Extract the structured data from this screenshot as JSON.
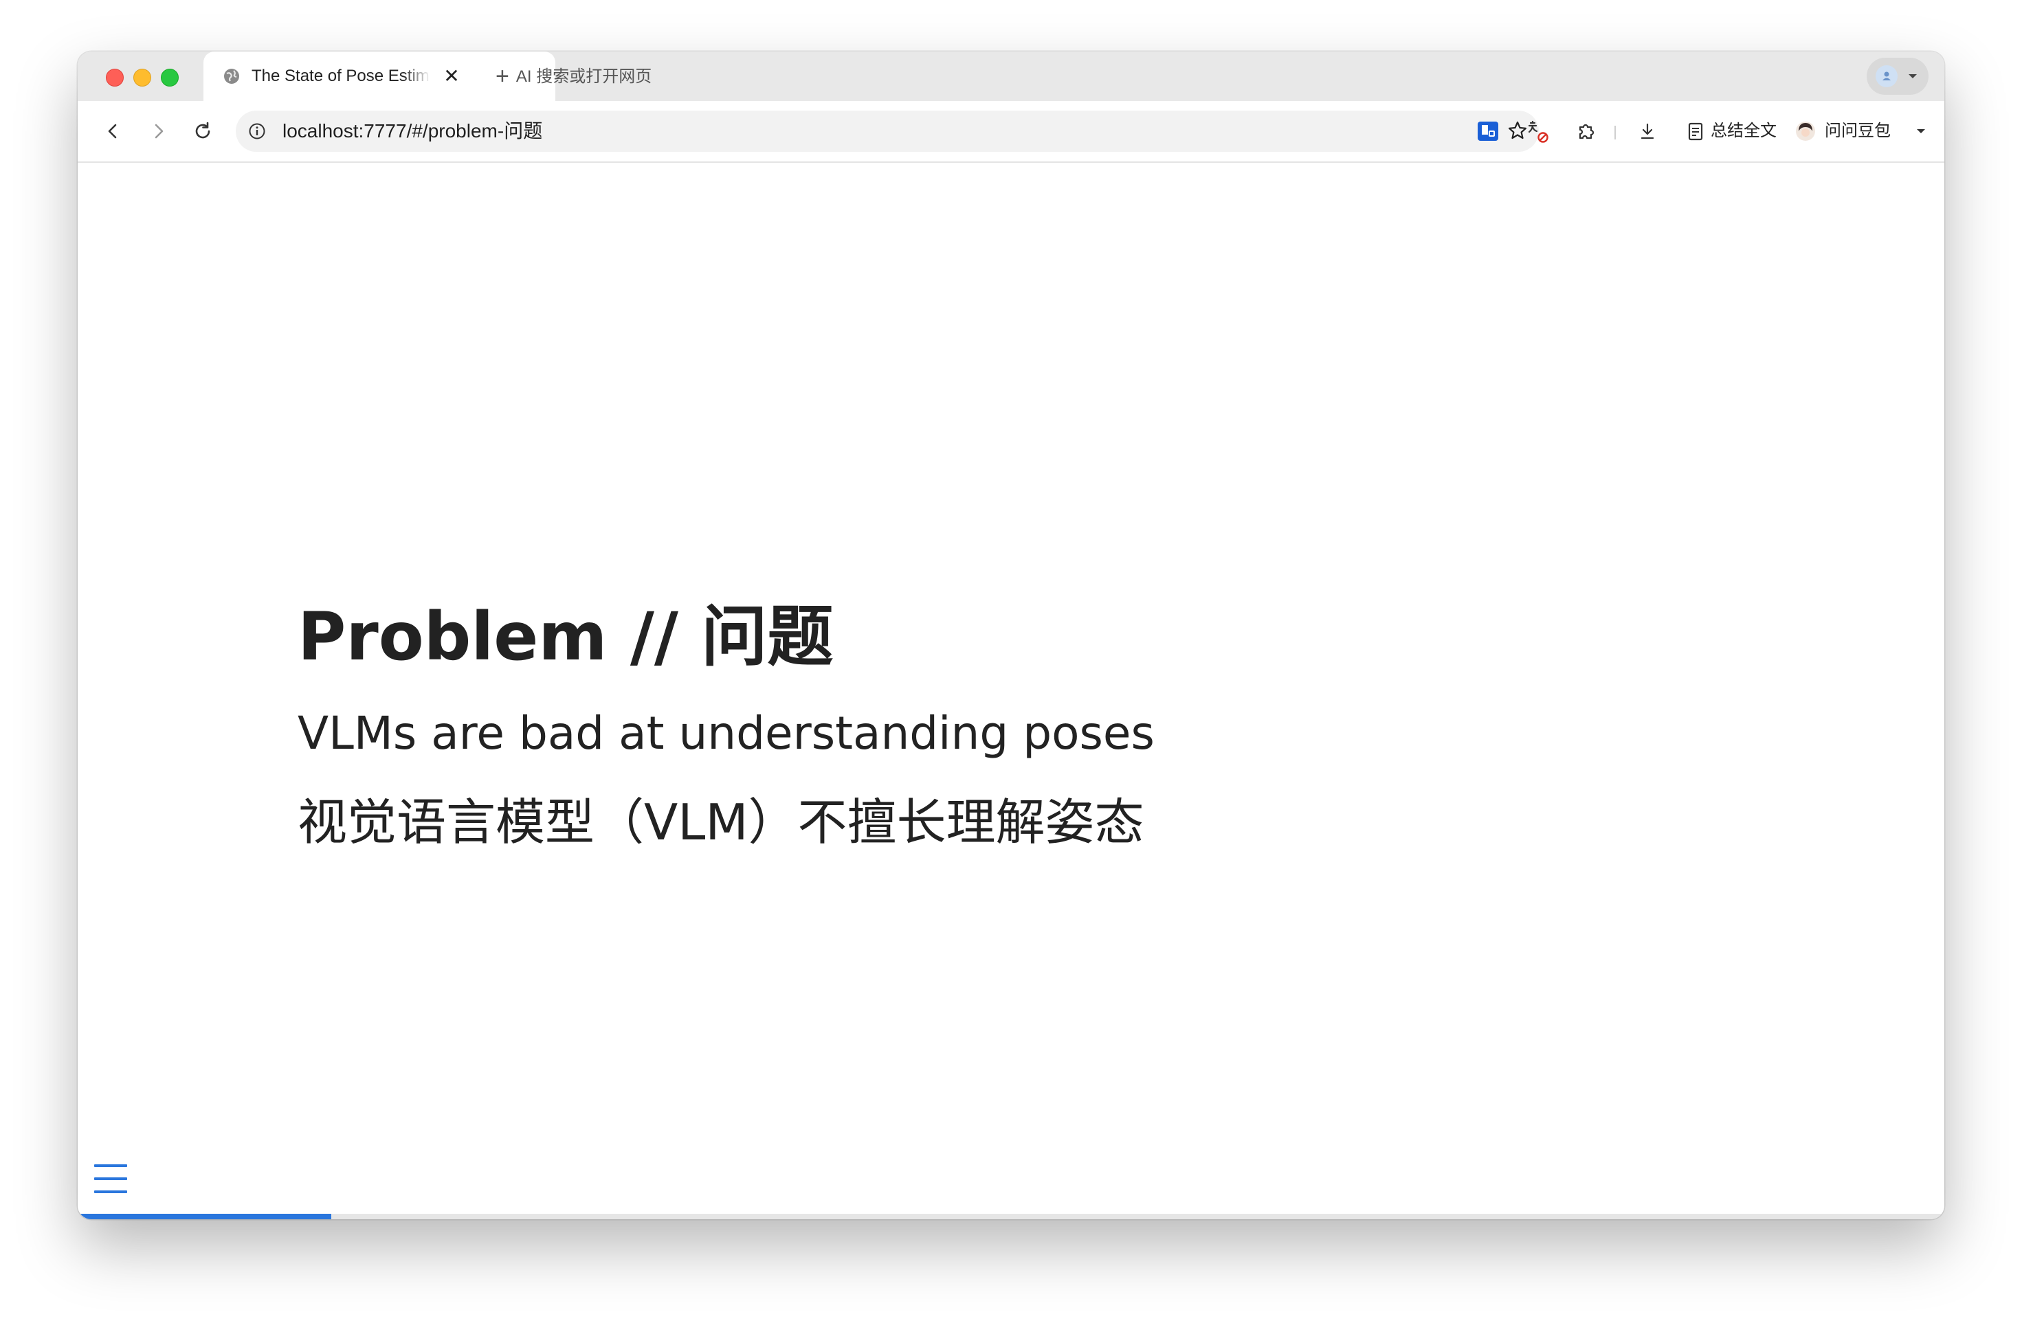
{
  "browser": {
    "tab": {
      "title": "The State of Pose Estimation",
      "close_glyph": "✕"
    },
    "new_tab": {
      "plus": "+",
      "label": "AI 搜索或打开网页"
    },
    "address": {
      "url": "localhost:7777/#/problem-问题"
    },
    "toolbar": {
      "summary_label": "总结全文",
      "doubao_label": "问问豆包"
    }
  },
  "slide": {
    "title": "Problem // 问题",
    "subtitle_en": "VLMs are bad at understanding poses",
    "subtitle_cn": "视觉语言模型（VLM）不擅长理解姿态"
  },
  "progress": {
    "fraction": 0.136
  },
  "colors": {
    "accent": "#2a76dd",
    "text": "#222222"
  }
}
